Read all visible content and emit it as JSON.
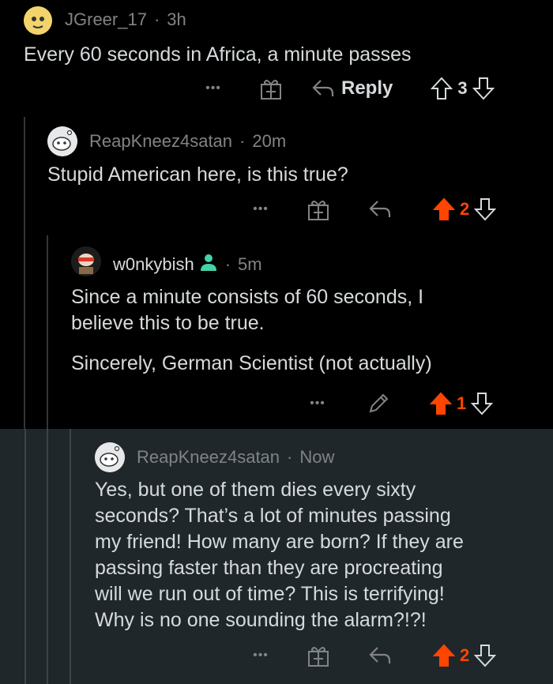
{
  "comments": [
    {
      "user": "JGreer_17",
      "time": "3h",
      "lines": [
        "Every 60 seconds in Africa, a minute passes"
      ],
      "reply_label": "Reply",
      "votes": "3",
      "upvoted": false
    },
    {
      "user": "ReapKneez4satan",
      "time": "20m",
      "lines": [
        "Stupid American here, is this true?"
      ],
      "votes": "2",
      "upvoted": true
    },
    {
      "user": "w0nkybish",
      "time": "5m",
      "lines": [
        "Since a minute consists of 60 seconds, I",
        "believe this to be true."
      ],
      "lines2": [
        "Sincerely, German Scientist (not actually)"
      ],
      "votes": "1",
      "upvoted": true
    },
    {
      "user": "ReapKneez4satan",
      "time": "Now",
      "lines": [
        "Yes, but one of them dies every sixty",
        "seconds? That’s a lot of minutes passing",
        "my friend! How many are born? If they are",
        "passing faster than they are procreating",
        "will we run out of time? This is terrifying!",
        "Why is no one sounding the alarm?!?!"
      ],
      "votes": "2",
      "upvoted": true
    }
  ],
  "separator": "·",
  "more_label": "•••",
  "colors": {
    "upvote": "#ff4500",
    "muted": "#818384",
    "text": "#d7dadc",
    "highlight_bg": "#1f272b"
  }
}
